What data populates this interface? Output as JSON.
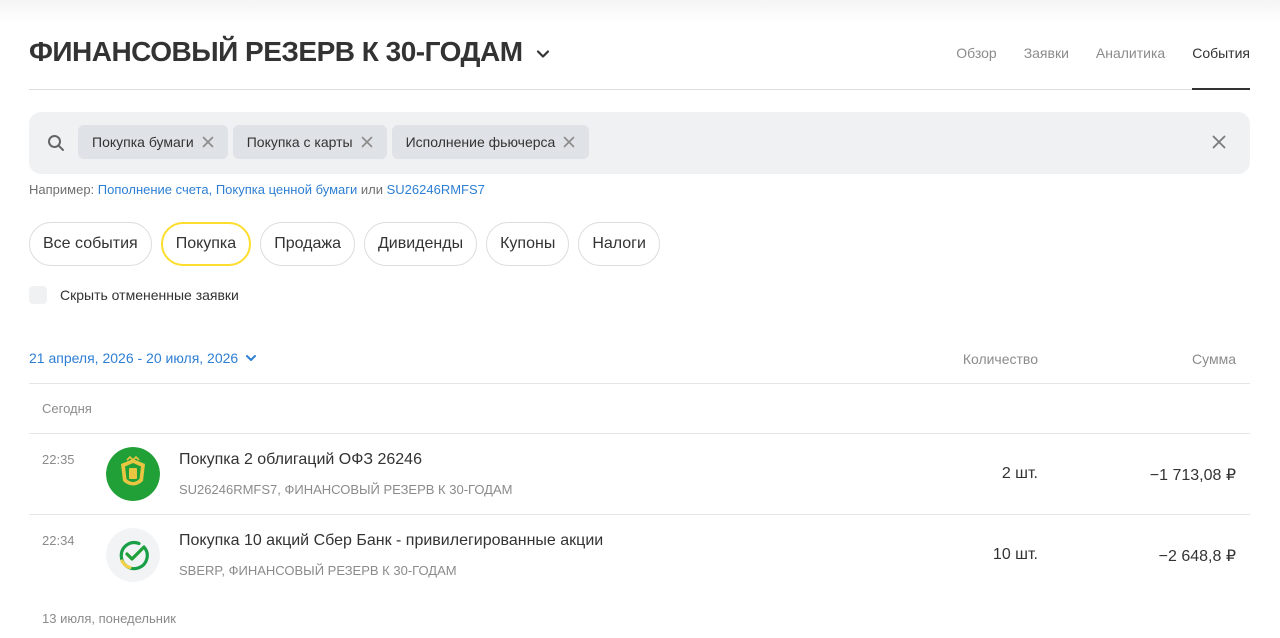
{
  "header": {
    "title": "ФИНАНСОВЫЙ РЕЗЕРВ К 30-ГОДАМ",
    "tabs": [
      {
        "label": "Обзор",
        "active": false
      },
      {
        "label": "Заявки",
        "active": false
      },
      {
        "label": "Аналитика",
        "active": false
      },
      {
        "label": "События",
        "active": true
      }
    ]
  },
  "search": {
    "chips": [
      "Покупка бумаги",
      "Покупка с карты",
      "Исполнение фьючерса"
    ]
  },
  "hint": {
    "prefix": "Например:",
    "link1": "Пополнение счета, Покупка ценной бумаги",
    "separator": "или",
    "link2": "SU26246RMFS7"
  },
  "filters": {
    "pills": [
      "Все события",
      "Покупка",
      "Продажа",
      "Дивиденды",
      "Купоны",
      "Налоги"
    ],
    "active": "Покупка"
  },
  "checkbox": {
    "label": "Скрыть отмененные заявки",
    "checked": false
  },
  "table": {
    "date_range": "21 апреля, 2026 - 20 июля, 2026",
    "col_qty": "Количество",
    "col_sum": "Сумма"
  },
  "groups": [
    {
      "label": "Сегодня",
      "rows": [
        {
          "time": "22:35",
          "title": "Покупка 2 облигаций ОФЗ 26246",
          "subtitle": "SU26246RMFS7, ФИНАНСОВЫЙ РЕЗЕРВ К 30-ГОДАМ",
          "qty": "2 шт.",
          "sum": "−1 713,08 ₽",
          "logo": "minfin-emblem-icon"
        },
        {
          "time": "22:34",
          "title": "Покупка 10 акций Сбер Банк - привилегированные акции",
          "subtitle": "SBERP, ФИНАНСОВЫЙ РЕЗЕРВ К 30-ГОДАМ",
          "qty": "10 шт.",
          "sum": "−2 648,8 ₽",
          "logo": "sber-logo-icon"
        }
      ]
    },
    {
      "label": "13 июля, понедельник",
      "rows": []
    }
  ],
  "colors": {
    "accent_yellow": "#ffdd2d",
    "link_blue": "#2e7fd4",
    "minfin_green": "#21a038"
  }
}
